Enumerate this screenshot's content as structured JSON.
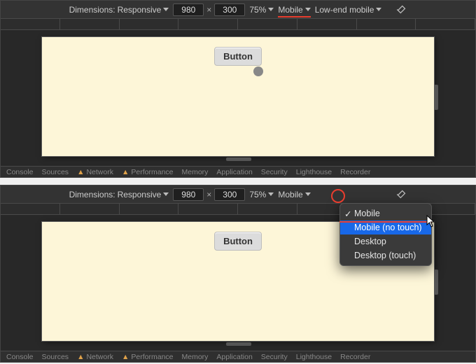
{
  "toolbar": {
    "dimensions_label": "Dimensions:",
    "dimensions_value": "Responsive",
    "width": "980",
    "height": "300",
    "zoom": "75%",
    "device_type": "Mobile",
    "throttle": "Low-end mobile"
  },
  "content": {
    "button_label": "Button"
  },
  "menu": {
    "items": [
      {
        "label": "Mobile",
        "checked": true,
        "selected": false
      },
      {
        "label": "Mobile (no touch)",
        "checked": false,
        "selected": true
      },
      {
        "label": "Desktop",
        "checked": false,
        "selected": false
      },
      {
        "label": "Desktop (touch)",
        "checked": false,
        "selected": false
      }
    ]
  },
  "tabs": {
    "t0": "Console",
    "t1": "Sources",
    "t2": "Network",
    "t3": "Performance",
    "t4": "Memory",
    "t5": "Application",
    "t6": "Security",
    "t7": "Lighthouse",
    "t8": "Recorder"
  }
}
